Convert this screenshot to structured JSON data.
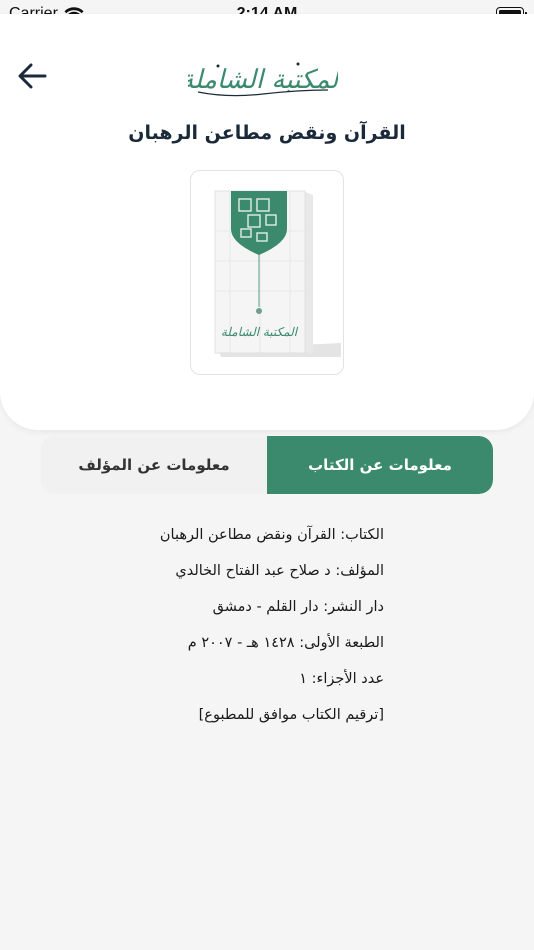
{
  "status_bar": {
    "carrier": "Carrier",
    "time": "2:14 AM"
  },
  "header": {
    "logo_text": "المكتبة الشاملة",
    "book_title": "القرآن ونقض مطاعن الرهبان",
    "cover_logo_text": "المكتبة الشاملة"
  },
  "tabs": [
    {
      "label": "معلومات عن المؤلف",
      "active": false
    },
    {
      "label": "معلومات عن الكتاب",
      "active": true
    }
  ],
  "info": {
    "book": "الكتاب: القرآن ونقض مطاعن الرهبان",
    "author": "المؤلف: د صلاح عبد الفتاح الخالدي",
    "publisher": "دار النشر: دار القلم - دمشق",
    "edition": "الطبعة الأولى: ١٤٢٨ هـ - ٢٠٠٧ م",
    "volumes": "عدد الأجزاء: ١",
    "note": "[ترقيم الكتاب موافق للمطبوع]"
  },
  "colors": {
    "accent": "#3b8a6e",
    "title": "#1b2a3a"
  }
}
